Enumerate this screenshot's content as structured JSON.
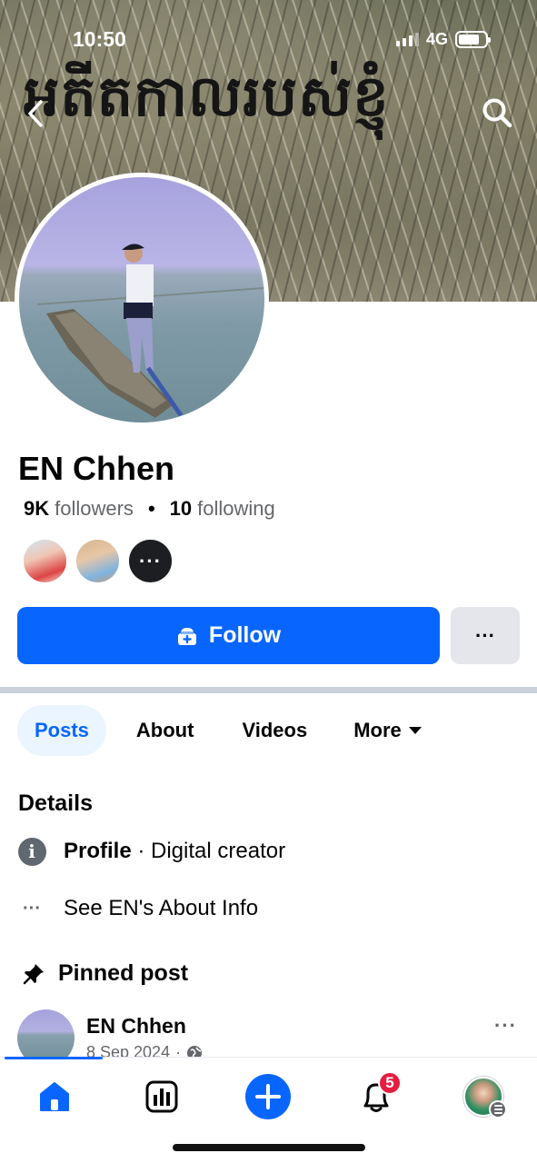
{
  "status_bar": {
    "time": "10:50",
    "network": "4G"
  },
  "cover": {
    "title_text": "អតីតកាលរបស់ខ្ញុំ"
  },
  "profile": {
    "name": "EN Chhen",
    "followers_count": "9K",
    "followers_label": "followers",
    "separator": "•",
    "following_count": "10",
    "following_label": "following",
    "more_friends_label": "···"
  },
  "actions": {
    "follow_label": "Follow",
    "more_label": "···"
  },
  "tabs": [
    {
      "label": "Posts",
      "active": true
    },
    {
      "label": "About",
      "active": false
    },
    {
      "label": "Videos",
      "active": false
    },
    {
      "label": "More",
      "active": false
    }
  ],
  "details": {
    "heading": "Details",
    "profile_type_label": "Profile",
    "profile_type_sep": " · ",
    "profile_type_value": "Digital creator",
    "about_link": "See EN's About Info",
    "about_icon_label": "···"
  },
  "pinned": {
    "heading": "Pinned post",
    "post": {
      "author": "EN Chhen",
      "date": "8 Sep 2024",
      "date_sep": "·",
      "more_label": "···"
    }
  },
  "bottom_nav": {
    "items": [
      "home",
      "dashboard",
      "create",
      "notifications",
      "profile-menu"
    ],
    "notification_count": "5",
    "active": "home"
  },
  "colors": {
    "accent": "#0866ff",
    "badge": "#e41e3f",
    "secondary_button": "#e4e6eb",
    "active_tab_bg": "#ebf5ff"
  }
}
